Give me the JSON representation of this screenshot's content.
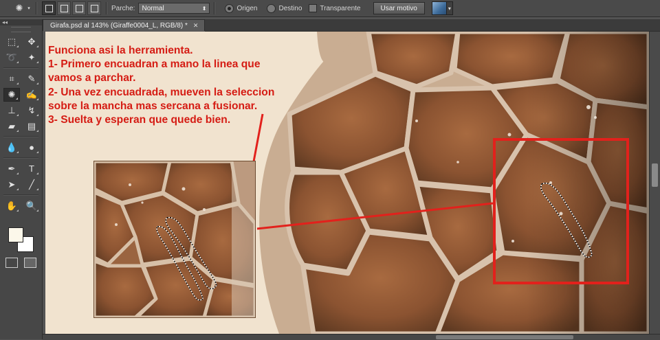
{
  "options_bar": {
    "parche_label": "Parche:",
    "parche_value": "Normal",
    "origen_label": "Origen",
    "destino_label": "Destino",
    "transparente_label": "Transparente",
    "use_pattern_button": "Usar motivo",
    "selected_mode": "origen"
  },
  "document": {
    "tab_title": "Girafa.psd al 143% (Giraffe0004_L, RGB/8) *"
  },
  "annotation": {
    "text": "Funciona asi la herramienta.\n1- Primero encuadran a mano la linea que vamos a parchar.\n2- Una vez encuadrada, mueven la seleccion sobre la mancha mas sercana a fusionar.\n3- Suelta y esperan que quede bien."
  },
  "toolbar": {
    "tools": [
      [
        "marquee-icon",
        "move-icon"
      ],
      [
        "lasso-icon",
        "magic-wand-icon"
      ],
      [
        "crop-icon",
        "eyedropper-icon"
      ],
      [
        "patch-icon",
        "brush-icon"
      ],
      [
        "stamp-icon",
        "history-brush-icon"
      ],
      [
        "eraser-icon",
        "gradient-icon"
      ],
      [
        "blur-icon",
        "dodge-icon"
      ],
      [
        "pen-icon",
        "type-icon"
      ],
      [
        "path-select-icon",
        "line-icon"
      ],
      [
        "hand-icon",
        "zoom-icon"
      ]
    ],
    "active_tool": "patch-icon"
  },
  "colors": {
    "foreground": "#fcf7ea",
    "background": "#ffffff",
    "annotation_red": "#d51c14"
  }
}
